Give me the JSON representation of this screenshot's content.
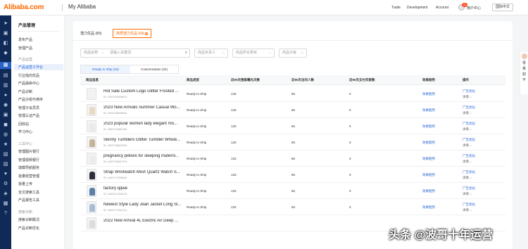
{
  "header": {
    "logo": "Alibaba.com",
    "app_title": "My Alibaba",
    "nav": [
      "Trade",
      "Development",
      "Account"
    ],
    "user_badge": "11",
    "user_name": "用户中心",
    "language": "国际中文"
  },
  "sidebar": {
    "title": "产品管理",
    "sections": [
      {
        "group": "",
        "items": [
          "发布产品",
          "管理产品"
        ]
      },
      {
        "group": "产品运营",
        "items": [
          "产品运营工作台",
          "行业指向优品",
          "产品操纵中心",
          "产品诊断",
          "产品分组与排序",
          "管理子会员员",
          "管理认证产品",
          "回收站",
          "学习中心"
        ]
      },
      {
        "group": "工具中心",
        "items": [
          "管理图片银行",
          "管理视频银行",
          "填模导航服务",
          "批量经营管理",
          "批量上传",
          "全文搜索工具",
          "产品报告工具"
        ]
      },
      {
        "group": "搜索诊断",
        "items": [
          "搜索诊断概况",
          "产品诊断优化"
        ]
      }
    ],
    "active_item": "产品运营工作台"
  },
  "tabs": [
    {
      "label": "潜力优品 (80)",
      "active": false
    },
    {
      "label": "高质潜力优品 (68)",
      "active": true
    }
  ],
  "filters": {
    "product_field": "商品名称",
    "search_placeholder": "请输入关键词",
    "owner": "商品负责人",
    "category": "商品所在类目",
    "grade": "商品分级"
  },
  "subtabs": [
    {
      "label": "Ready to Ship (34)",
      "active": true
    },
    {
      "label": "Customization (32)",
      "active": false
    }
  ],
  "table": {
    "headers": [
      "商品信息",
      "商品类型",
      "近90天搜索曝光次数",
      "近90天访问人数",
      "近90天支付买家数",
      "效果趋势",
      "操作"
    ],
    "action_primary": "广告优化",
    "action_secondary": "详情",
    "trend_link": "效果趋势",
    "rows": [
      {
        "name": "Hot Sale Custom Logo Glitter Frosted ...",
        "id": "ID: 1600768308614",
        "type": "Ready to Ship",
        "exposure": "133",
        "visitors": "65",
        "buyers": "0",
        "thumb_color": "#f5f5f5",
        "has_image": false
      },
      {
        "name": "2023 New Arrivals Summer Casual Wo...",
        "id": "ID: 1600768648904",
        "type": "Ready to Ship",
        "exposure": "133",
        "visitors": "65",
        "buyers": "0",
        "thumb_color": "#e9d9c4",
        "has_image": true
      },
      {
        "name": "2023 popular women lady elegant mo...",
        "id": "ID: 1600740687184",
        "type": "Ready to Ship",
        "exposure": "133",
        "visitors": "65",
        "buyers": "0",
        "thumb_color": "#eaeaea",
        "has_image": true
      },
      {
        "name": "Skinny Tumblers Glitter Tumbler Whole...",
        "id": "ID: 1600758621625",
        "type": "Ready to Ship",
        "exposure": "133",
        "visitors": "65",
        "buyers": "0",
        "thumb_color": "#c7b49a",
        "has_image": true
      },
      {
        "name": "pregnancy pillows for sleeping materni...",
        "id": "ID: 1600758607475",
        "type": "Ready to Ship",
        "exposure": "133",
        "visitors": "65",
        "buyers": "0",
        "thumb_color": "#ececec",
        "has_image": true
      },
      {
        "name": "Strap Wristwatch Movt Quartz Watch S...",
        "id": "ID: 1600717598084",
        "type": "Ready to Ship",
        "exposure": "133",
        "visitors": "65",
        "buyers": "0",
        "thumb_color": "#2b2f3a",
        "has_image": true
      },
      {
        "name": "factory qqwe",
        "id": "ID: 1600427532215",
        "type": "Ready to Ship",
        "exposure": "133",
        "visitors": "65",
        "buyers": "0",
        "thumb_color": "#5b7fa6",
        "has_image": true
      },
      {
        "name": "Newest Style Lady Jean Jacket Long Sl...",
        "id": "ID: 1600717532124",
        "type": "Ready to Ship",
        "exposure": "133",
        "visitors": "65",
        "buyers": "0",
        "thumb_color": "#a9bcd6",
        "has_image": true
      },
      {
        "name": "2022 New Arrival 4L Electric Air Deep ...",
        "id": "",
        "type": "",
        "exposure": "",
        "visitors": "",
        "buyers": "",
        "thumb_color": "#dcdcdc",
        "has_image": true
      }
    ]
  },
  "right_edge": {
    "chars": [
      "零",
      "吴",
      "如",
      "不"
    ]
  },
  "watermark": "头条 @波哥十年运营",
  "colors": {
    "accent": "#ff6a00",
    "link": "#1a5fd1",
    "rail": "#0f2a56"
  }
}
